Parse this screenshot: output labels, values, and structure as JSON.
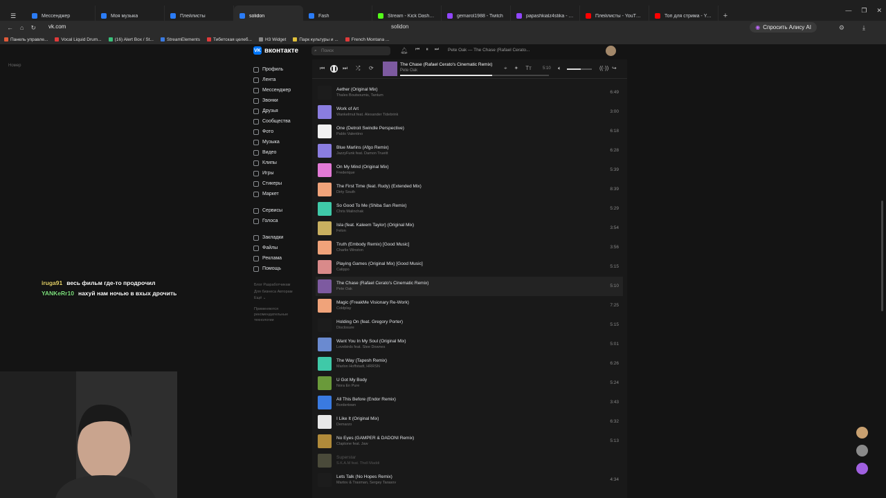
{
  "browser": {
    "tabs": [
      {
        "label": "Мессенджер",
        "color": "#2b7cf6"
      },
      {
        "label": "Моя музыка",
        "color": "#2b7cf6"
      },
      {
        "label": "Плейлисты",
        "color": "#2b7cf6"
      },
      {
        "label": "solidon",
        "color": "#2b7cf6",
        "active": true
      },
      {
        "label": "Fash",
        "color": "#2b7cf6"
      },
      {
        "label": "Stream - Kick Dashboard",
        "color": "#53fc18"
      },
      {
        "label": "gemarol1988 - Twitch",
        "color": "#9146ff"
      },
      {
        "label": "papashkialz4stika - Twitch",
        "color": "#9146ff"
      },
      {
        "label": "Плейлисты - YouTube",
        "color": "#ff0000"
      },
      {
        "label": "Топ для стрима - YouTube",
        "color": "#ff0000"
      }
    ],
    "url": "vk.com",
    "page_title": "solidon",
    "alice_label": "Спросить Алису AI",
    "bookmarks": [
      {
        "label": "Панель управле...",
        "color": "#e05a3a"
      },
      {
        "label": "Vocal Liquid Drum...",
        "color": "#e03a3a"
      },
      {
        "label": "(16) Alert Box / St...",
        "color": "#3ac07a"
      },
      {
        "label": "StreamElements",
        "color": "#3a7ae0"
      },
      {
        "label": "Тибетская целеб...",
        "color": "#e03a3a"
      },
      {
        "label": "H3 Widget",
        "color": "#888888"
      },
      {
        "label": "Парк культуры и ...",
        "color": "#e0c03a"
      },
      {
        "label": "French Montana ...",
        "color": "#e03a3a"
      }
    ]
  },
  "vk": {
    "logo": "вконтакте",
    "search_placeholder": "Поиск",
    "mini_track": "Pete Oak — The Chase (Rafael Cerato...",
    "sidebar_main": [
      "Профиль",
      "Лента",
      "Мессенджер",
      "Звонки",
      "Друзья",
      "Сообщества",
      "Фото",
      "Музыка",
      "Видео",
      "Клипы",
      "Игры",
      "Стикеры",
      "Маркет"
    ],
    "sidebar_services": [
      "Сервисы",
      "Голоса"
    ],
    "sidebar_extra": [
      "Закладки",
      "Файлы",
      "Реклама",
      "Помощь"
    ],
    "footer_line1": "Блог   Разработчикам",
    "footer_line2": "Для бизнеса   Авторам",
    "footer_line3": "Ещё ⌄",
    "footer_note": "Применяются рекомендательные технологии",
    "nomer": "Номер"
  },
  "player": {
    "title": "The Chase (Rafael Cerato's Cinematic Remix)",
    "artist": "Pete Oak",
    "time": "5:10",
    "progress": 0.62,
    "volume": 0.55
  },
  "tracks": [
    {
      "title": "Aether (Original Mix)",
      "artist": "Thales Boutsoumis, Tantum",
      "dur": "6:49",
      "color": "#1c1c1c"
    },
    {
      "title": "Work of Art",
      "artist": "Wankelmut feat. Alexander Tidebrink",
      "dur": "3:00",
      "color": "#8a7de0"
    },
    {
      "title": "One (Detroit Swindle Perspective)",
      "artist": "Pablo Valentino",
      "dur": "6:18",
      "color": "#f0f0f0"
    },
    {
      "title": "Blue Marlins (Afgo Remix)",
      "artist": "JazzyFunk feat. Damon Trueitt",
      "dur": "6:28",
      "color": "#8a7de0"
    },
    {
      "title": "On My Mind (Original Mix)",
      "artist": "Frederique",
      "dur": "5:39",
      "color": "#e27ad6"
    },
    {
      "title": "The First Time (feat. Rudy) (Extended Mix)",
      "artist": "Dirty South",
      "dur": "8:39",
      "color": "#f0a37a"
    },
    {
      "title": "So Good To Me (Shiba San Remix)",
      "artist": "Chris Malinchak",
      "dur": "5:29",
      "color": "#3fc9a8"
    },
    {
      "title": "Isla (feat. Kaleem Taylor) (Original Mix)",
      "artist": "Felon",
      "dur": "3:54",
      "color": "#c9b060"
    },
    {
      "title": "Truth (Embody Remix) [Good Music]",
      "artist": "Charlie Winston",
      "dur": "3:56",
      "color": "#f0a37a"
    },
    {
      "title": "Playing Games (Original Mix) [Good Music]",
      "artist": "Calippo",
      "dur": "5:15",
      "color": "#d98a8a"
    },
    {
      "title": "The Chase (Rafael Cerato's Cinematic Remix)",
      "artist": "Pete Oak",
      "dur": "5:10",
      "color": "#7d5aa0",
      "current": true
    },
    {
      "title": "Magic (FreakMe Visionary Re-Work)",
      "artist": "Coldplay",
      "dur": "7:25",
      "color": "#f0a37a"
    },
    {
      "title": "Holding On (feat. Gregory Porter)",
      "artist": "Disclosure",
      "dur": "5:15",
      "color": "#1c1c1c"
    },
    {
      "title": "Want You In My Soul (Original Mix)",
      "artist": "Lovebirds feat. Stee Downes",
      "dur": "5:01",
      "color": "#6a8ad0"
    },
    {
      "title": "The Way (Tapesh Remix)",
      "artist": "Marlon Hoffstadt, HRRSN",
      "dur": "6:26",
      "color": "#3fc9a8"
    },
    {
      "title": "U Got My Body",
      "artist": "Nora En Pure",
      "dur": "5:24",
      "color": "#6a9a3a"
    },
    {
      "title": "All This Before (Endor Remix)",
      "artist": "Bordertown",
      "dur": "3:43",
      "color": "#3a7ae0"
    },
    {
      "title": "I Like It (Original Mix)",
      "artist": "Demarzo",
      "dur": "6:32",
      "color": "#e8e8e8"
    },
    {
      "title": "No Eyes (GAMPER & DADONI Remix)",
      "artist": "Claptone feat. Jaw",
      "dur": "5:13",
      "color": "#b08a3a"
    },
    {
      "title": "Superstar",
      "artist": "S.K.A.M feat. Thell Maddi",
      "dur": "",
      "color": "#4a4a3a",
      "dim": true
    },
    {
      "title": "Lets Talk (No Hopes Remix)",
      "artist": "Martov & Traxman, Sergey Tarasov",
      "dur": "4:34",
      "color": "#1c1c1c"
    }
  ],
  "chat": [
    {
      "user": "iruga91",
      "msg": "весь фильм где-то продрочил"
    },
    {
      "user": "YANKeRr10",
      "msg": "нахуй нам ночью в вхых дрочить"
    }
  ]
}
